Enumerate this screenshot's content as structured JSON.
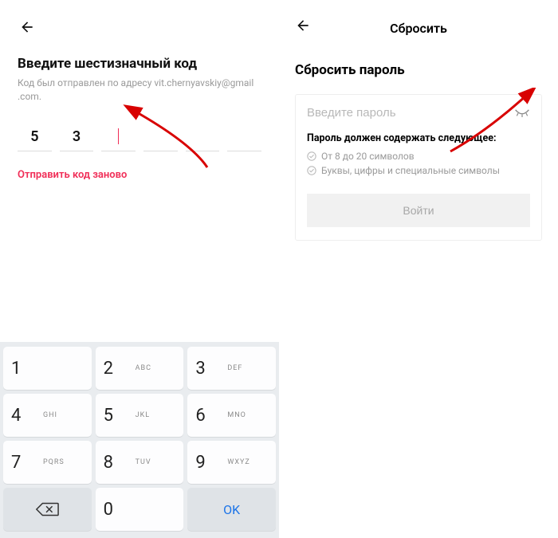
{
  "left": {
    "title": "Введите шестизначный код",
    "subtitle_prefix": "Код был отправлен по адресу ",
    "email_part1": "vit.chernyavskiy@gmail",
    "email_part2": ".com.",
    "code_digits": [
      "5",
      "3",
      "",
      "",
      "",
      ""
    ],
    "resend_label": "Отправить код заново"
  },
  "keypad": {
    "keys": [
      [
        {
          "d": "1",
          "l": ""
        },
        {
          "d": "2",
          "l": "ABC"
        },
        {
          "d": "3",
          "l": "DEF"
        }
      ],
      [
        {
          "d": "4",
          "l": "GHI"
        },
        {
          "d": "5",
          "l": "JKL"
        },
        {
          "d": "6",
          "l": "MNO"
        }
      ],
      [
        {
          "d": "7",
          "l": "PQRS"
        },
        {
          "d": "8",
          "l": "TUV"
        },
        {
          "d": "9",
          "l": "WXYZ"
        }
      ]
    ],
    "zero": "0",
    "ok": "OK"
  },
  "right": {
    "header_title": "Сбросить",
    "title": "Сбросить пароль",
    "password_placeholder": "Введите пароль",
    "req_heading": "Пароль должен содержать следующее:",
    "req1": "От 8 до 20 символов",
    "req2": "Буквы, цифры и специальные символы",
    "login_label": "Войти"
  }
}
